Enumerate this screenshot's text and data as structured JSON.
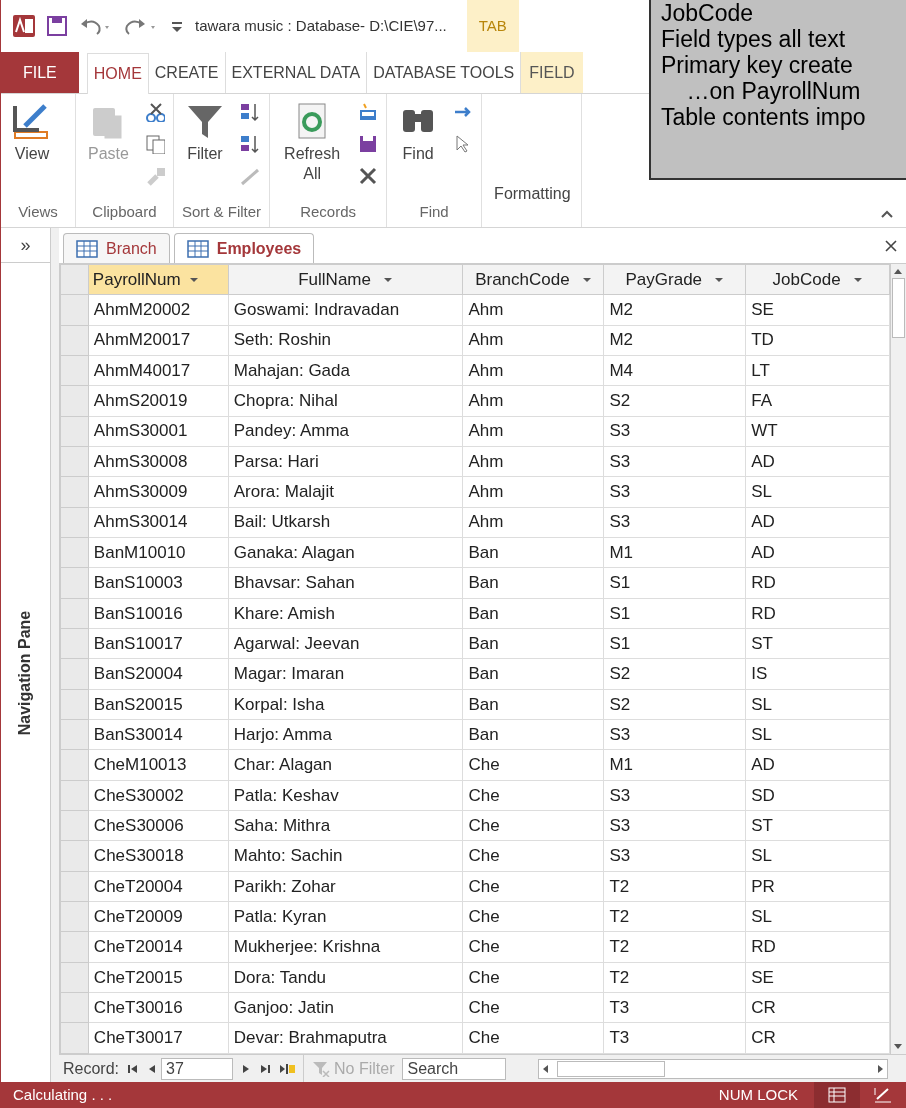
{
  "title_bar": {
    "title": "tawara music : Database- D:\\CIE\\97...",
    "context_tab": "TAB"
  },
  "ribbon_tabs": [
    {
      "label": "FILE",
      "kind": "file",
      "selected": false
    },
    {
      "label": "HOME",
      "kind": "tab",
      "selected": true
    },
    {
      "label": "CREATE",
      "kind": "tab",
      "selected": false
    },
    {
      "label": "EXTERNAL DATA",
      "kind": "tab",
      "selected": false
    },
    {
      "label": "DATABASE TOOLS",
      "kind": "tab",
      "selected": false
    },
    {
      "label": "FIELD",
      "kind": "context",
      "selected": false
    }
  ],
  "ribbon_groups": [
    {
      "label": "Views",
      "buttons": [
        {
          "label": "View",
          "kind": "view",
          "disabled": false
        }
      ]
    },
    {
      "label": "Clipboard",
      "buttons": [
        {
          "label": "Paste",
          "kind": "paste",
          "disabled": true
        }
      ]
    },
    {
      "label": "Sort & Filter",
      "buttons": [
        {
          "label": "Filter",
          "kind": "filter",
          "disabled": false
        }
      ]
    },
    {
      "label": "Records",
      "buttons": [
        {
          "label": "Refresh All",
          "kind": "refresh",
          "disabled": false
        }
      ]
    },
    {
      "label": "Find",
      "buttons": [
        {
          "label": "Find",
          "kind": "find",
          "disabled": false
        }
      ]
    },
    {
      "buttons": [
        {
          "label": "Formatting",
          "kind": "formatting",
          "disabled": false
        }
      ]
    }
  ],
  "note": {
    "lines": [
      "JobCode",
      "Field types all text",
      "Primary key create",
      "    …on PayrollNum",
      "Table contents impo"
    ]
  },
  "navigation_pane": {
    "toggle": "»",
    "label": "Navigation Pane"
  },
  "document_tabs": [
    {
      "label": "Branch",
      "selected": false
    },
    {
      "label": "Employees",
      "selected": true
    }
  ],
  "table": {
    "columns": [
      {
        "label": "PayrollNum",
        "selected": true
      },
      {
        "label": "FullName",
        "selected": false
      },
      {
        "label": "BranchCode",
        "selected": false
      },
      {
        "label": "PayGrade",
        "selected": false
      },
      {
        "label": "JobCode",
        "selected": false
      }
    ],
    "rows": [
      [
        "AhmM20002",
        "Goswami: Indravadan",
        "Ahm",
        "M2",
        "SE"
      ],
      [
        "AhmM20017",
        "Seth: Roshin",
        "Ahm",
        "M2",
        "TD"
      ],
      [
        "AhmM40017",
        "Mahajan: Gada",
        "Ahm",
        "M4",
        "LT"
      ],
      [
        "AhmS20019",
        "Chopra: Nihal",
        "Ahm",
        "S2",
        "FA"
      ],
      [
        "AhmS30001",
        "Pandey: Amma",
        "Ahm",
        "S3",
        "WT"
      ],
      [
        "AhmS30008",
        "Parsa: Hari",
        "Ahm",
        "S3",
        "AD"
      ],
      [
        "AhmS30009",
        "Arora: Malajit",
        "Ahm",
        "S3",
        "SL"
      ],
      [
        "AhmS30014",
        "Bail: Utkarsh",
        "Ahm",
        "S3",
        "AD"
      ],
      [
        "BanM10010",
        "Ganaka: Alagan",
        "Ban",
        "M1",
        "AD"
      ],
      [
        "BanS10003",
        "Bhavsar: Sahan",
        "Ban",
        "S1",
        "RD"
      ],
      [
        "BanS10016",
        "Khare: Amish",
        "Ban",
        "S1",
        "RD"
      ],
      [
        "BanS10017",
        "Agarwal: Jeevan",
        "Ban",
        "S1",
        "ST"
      ],
      [
        "BanS20004",
        "Magar: Imaran",
        "Ban",
        "S2",
        "IS"
      ],
      [
        "BanS20015",
        "Korpal: Isha",
        "Ban",
        "S2",
        "SL"
      ],
      [
        "BanS30014",
        "Harjo: Amma",
        "Ban",
        "S3",
        "SL"
      ],
      [
        "CheM10013",
        "Char: Alagan",
        "Che",
        "M1",
        "AD"
      ],
      [
        "CheS30002",
        "Patla: Keshav",
        "Che",
        "S3",
        "SD"
      ],
      [
        "CheS30006",
        "Saha: Mithra",
        "Che",
        "S3",
        "ST"
      ],
      [
        "CheS30018",
        "Mahto: Sachin",
        "Che",
        "S3",
        "SL"
      ],
      [
        "CheT20004",
        "Parikh: Zohar",
        "Che",
        "T2",
        "PR"
      ],
      [
        "CheT20009",
        "Patla: Kyran",
        "Che",
        "T2",
        "SL"
      ],
      [
        "CheT20014",
        "Mukherjee: Krishna",
        "Che",
        "T2",
        "RD"
      ],
      [
        "CheT20015",
        "Dora: Tandu",
        "Che",
        "T2",
        "SE"
      ],
      [
        "CheT30016",
        "Ganjoo: Jatin",
        "Che",
        "T3",
        "CR"
      ],
      [
        "CheT30017",
        "Devar: Brahmaputra",
        "Che",
        "T3",
        "CR"
      ]
    ]
  },
  "record_navigator": {
    "label": "Record:",
    "current": "37",
    "filter": "No Filter",
    "search": "Search"
  },
  "status_bar": {
    "message": "Calculating . . .",
    "indicator": "NUM LOCK"
  }
}
